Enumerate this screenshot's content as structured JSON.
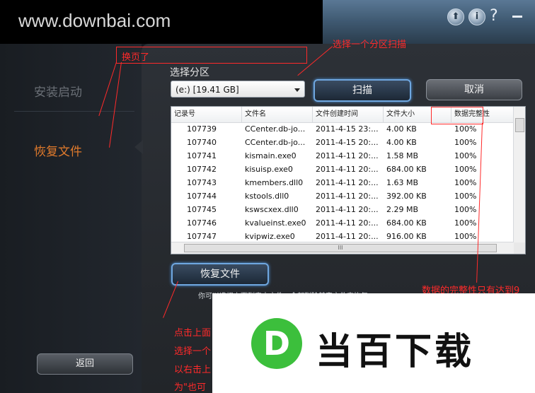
{
  "watermark": "www.downbai.com",
  "toolbar": {
    "up_icon": "⬆",
    "info_icon": "i",
    "help": "?",
    "minimize": "–"
  },
  "sidebar": {
    "items": [
      {
        "label": "安装启动",
        "active": false
      },
      {
        "label": "恢复文件",
        "active": true
      }
    ],
    "back_label": "返回"
  },
  "main": {
    "partition_label": "选择分区",
    "partition_value": "(e:) [19.41 GB]",
    "scan_label": "扫描",
    "cancel_label": "取消",
    "recover_label": "恢复文件",
    "info_text": "你可以选择上面列表中文件，全部列除其实文件来恢复"
  },
  "table": {
    "headers": [
      "记录号",
      "文件名",
      "文件创建时间",
      "文件大小",
      "数据完整性"
    ],
    "rows": [
      [
        "107739",
        "CCenter.db-jo...",
        "2011-4-15 23:...",
        "4.00 KB",
        "100%"
      ],
      [
        "107740",
        "CCenter.db-jo...",
        "2011-4-15 20:...",
        "4.00 KB",
        "100%"
      ],
      [
        "107741",
        "kismain.exe0",
        "2011-4-11 20:...",
        "1.58 MB",
        "100%"
      ],
      [
        "107742",
        "kisuisp.exe0",
        "2011-4-11 20:...",
        "684.00 KB",
        "100%"
      ],
      [
        "107743",
        "kmembers.dll0",
        "2011-4-11 20:...",
        "1.63 MB",
        "100%"
      ],
      [
        "107744",
        "kstools.dll0",
        "2011-4-11 20:...",
        "392.00 KB",
        "100%"
      ],
      [
        "107745",
        "kswscxex.dll0",
        "2011-4-11 20:...",
        "2.29 MB",
        "100%"
      ],
      [
        "107746",
        "kvalueinst.exe0",
        "2011-4-11 20:...",
        "684.00 KB",
        "100%"
      ],
      [
        "107747",
        "kvipwiz.exe0",
        "2011-4-11 20:...",
        "916.00 KB",
        "100%"
      ]
    ],
    "hscroll_grip": "III"
  },
  "annotations": {
    "page_change": "换页了",
    "select_partition_scan": "选择一个分区扫描",
    "integrity_note": "数据的完整性只有达到9",
    "click_note_1": "点击上面",
    "click_note_2": "选择一个",
    "click_note_3": "以右击上",
    "click_note_4": "为\"也可"
  },
  "logo": {
    "mark": "D",
    "text": "当百下载"
  },
  "colors": {
    "accent_blue": "#6fa7e0",
    "annotation_red": "#ff2a2a",
    "active_sidebar": "#e07a2c",
    "logo_green": "#3cbf3c"
  }
}
